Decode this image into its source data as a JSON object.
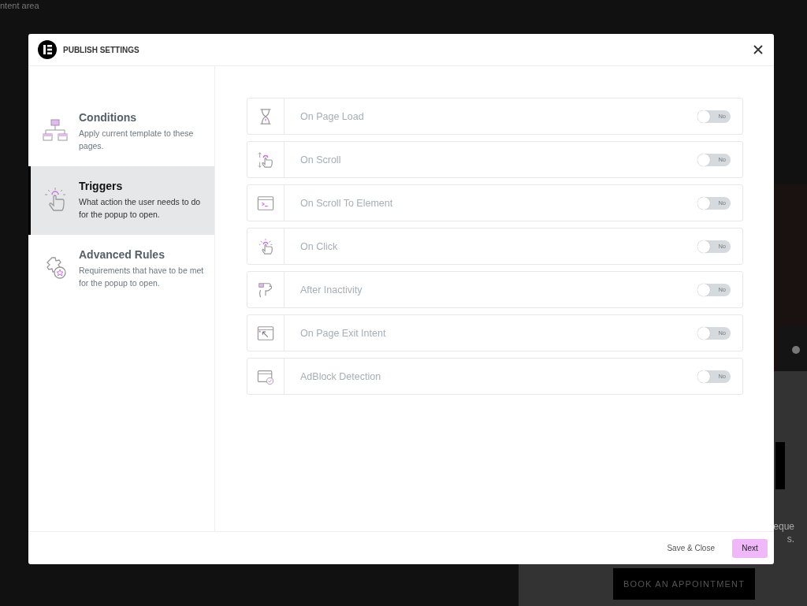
{
  "background_page": {
    "corner_text": "ntent area",
    "text_fragments": [
      "eque",
      "s."
    ],
    "cta_button": "BOOK AN APPOINTMENT"
  },
  "dialog": {
    "title": "PUBLISH SETTINGS",
    "sidebar": {
      "items": [
        {
          "title": "Conditions",
          "description": "Apply current template to these pages.",
          "selected": false
        },
        {
          "title": "Triggers",
          "description": "What action the user needs to do for the popup to open.",
          "selected": true
        },
        {
          "title": "Advanced Rules",
          "description": "Requirements that have to be met for the popup to open.",
          "selected": false
        }
      ]
    },
    "triggers": [
      {
        "label": "On Page Load",
        "on": false,
        "switch_text": "No"
      },
      {
        "label": "On Scroll",
        "on": false,
        "switch_text": "No"
      },
      {
        "label": "On Scroll To Element",
        "on": false,
        "switch_text": "No"
      },
      {
        "label": "On Click",
        "on": false,
        "switch_text": "No"
      },
      {
        "label": "After Inactivity",
        "on": false,
        "switch_text": "No"
      },
      {
        "label": "On Page Exit Intent",
        "on": false,
        "switch_text": "No"
      },
      {
        "label": "AdBlock Detection",
        "on": false,
        "switch_text": "No"
      }
    ],
    "footer": {
      "secondary_button": "Save & Close",
      "primary_button": "Next"
    }
  }
}
